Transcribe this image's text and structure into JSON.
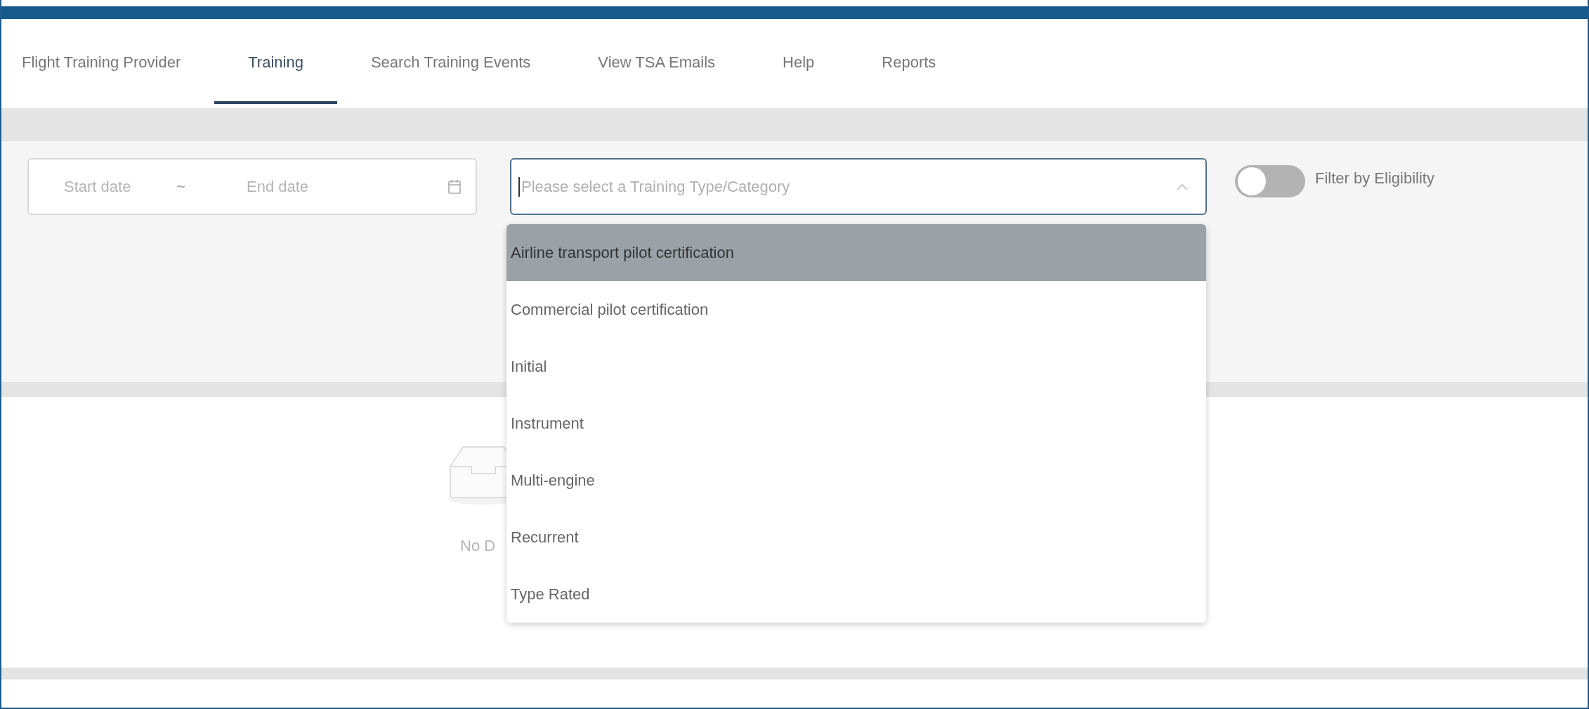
{
  "nav_tabs": [
    {
      "label": "Flight Training Provider",
      "selected": false
    },
    {
      "label": "Training",
      "selected": true
    },
    {
      "label": "Search Training Events",
      "selected": false
    },
    {
      "label": "View TSA Emails",
      "selected": false
    },
    {
      "label": "Help",
      "selected": false
    },
    {
      "label": "Reports",
      "selected": false
    }
  ],
  "filters": {
    "date_range": {
      "start_placeholder": "Start date",
      "separator": "~",
      "end_placeholder": "End date"
    },
    "training_type": {
      "placeholder": "Please select a Training Type/Category",
      "expanded": true,
      "options": [
        {
          "label": "Airline transport pilot certification",
          "highlighted": true
        },
        {
          "label": "Commercial pilot certification",
          "highlighted": false
        },
        {
          "label": "Initial",
          "highlighted": false
        },
        {
          "label": "Instrument",
          "highlighted": false
        },
        {
          "label": "Multi-engine",
          "highlighted": false
        },
        {
          "label": "Recurrent",
          "highlighted": false
        },
        {
          "label": "Type Rated",
          "highlighted": false
        }
      ]
    },
    "eligibility_toggle": {
      "label": "Filter by Eligibility",
      "on": false
    }
  },
  "empty_state": {
    "text": "No D"
  }
}
